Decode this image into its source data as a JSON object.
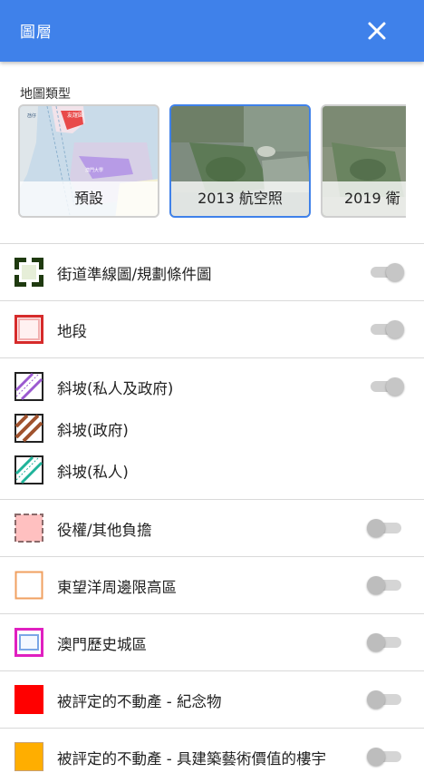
{
  "header": {
    "title": "圖層",
    "close_icon": "close-icon"
  },
  "map_types": {
    "label": "地圖類型",
    "options": [
      {
        "caption": "預設",
        "selected": false
      },
      {
        "caption": "2013 航空照",
        "selected": true
      },
      {
        "caption": "2019 衛",
        "selected": false
      }
    ],
    "thumb_labels": {
      "road_tag": "友誼圓",
      "district_tag": "氹仔",
      "bottom_tag": "澳門大學"
    }
  },
  "layers": [
    {
      "label": "街道準線圖/規劃條件圖",
      "toggle": "on",
      "symbol": "dark-green-dashed-square"
    },
    {
      "label": "地段",
      "toggle": "on",
      "symbol": "red-outline-square"
    },
    {
      "label": "斜坡(私人及政府)",
      "toggle": "on",
      "symbol": "purple-hatched-square"
    },
    {
      "label": "斜坡(政府)",
      "symbol": "brown-hatched-square"
    },
    {
      "label": "斜坡(私人)",
      "symbol": "teal-hatched-square"
    },
    {
      "label": "役權/其他負擔",
      "toggle": "off",
      "symbol": "pink-dashed-square"
    },
    {
      "label": "東望洋周邊限高區",
      "toggle": "off",
      "symbol": "orange-outline-square"
    },
    {
      "label": "澳門歷史城區",
      "toggle": "off",
      "symbol": "magenta-blue-square"
    },
    {
      "label": "被評定的不動產 - 紀念物",
      "toggle": "off",
      "symbol": "red-filled-square"
    },
    {
      "label": "被評定的不動產 - 具建築藝術價值的樓宇",
      "toggle": "off",
      "symbol": "orange-filled-square"
    }
  ],
  "colors": {
    "appbar": "#3f81ea",
    "selected_border": "#3f81ea",
    "slope_purple": "#9b59d0",
    "slope_brown": "#a0522d",
    "slope_teal": "#1fb39a",
    "monument_red": "#ff0000",
    "building_orange": "#ffae00"
  }
}
